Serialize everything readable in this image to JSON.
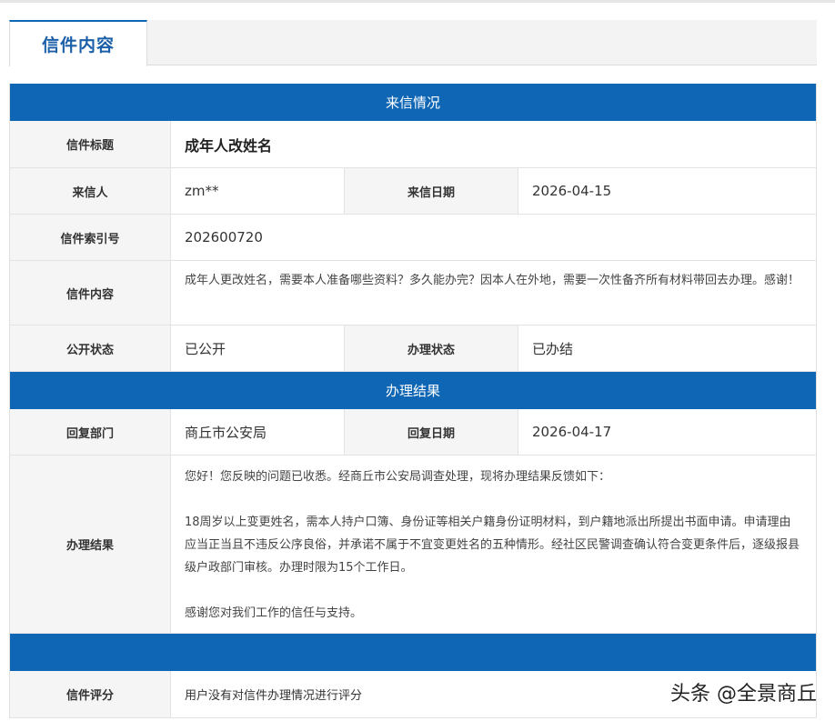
{
  "tab": {
    "label": "信件内容"
  },
  "section_letter": {
    "title": "来信情况"
  },
  "letter": {
    "title_label": "信件标题",
    "title_value": "成年人改姓名",
    "sender_label": "来信人",
    "sender_value": "zm**",
    "date_label": "来信日期",
    "date_value": "2026-04-15",
    "index_label": "信件索引号",
    "index_value": "202600720",
    "content_label": "信件内容",
    "content_value": "成年人更改姓名，需要本人准备哪些资料？多久能办完？因本人在外地，需要一次性备齐所有材料带回去办理。感谢！",
    "public_label": "公开状态",
    "public_value": "已公开",
    "process_label": "办理状态",
    "process_value": "已办结"
  },
  "section_result": {
    "title": "办理结果"
  },
  "result": {
    "dept_label": "回复部门",
    "dept_value": "商丘市公安局",
    "reply_date_label": "回复日期",
    "reply_date_value": "2026-04-17",
    "result_label": "办理结果",
    "paragraph_1": "您好！您反映的问题已收悉。经商丘市公安局调查处理，现将办理结果反馈如下：",
    "paragraph_2": "18周岁以上变更姓名，需本人持户口簿、身份证等相关户籍身份证明材料，到户籍地派出所提出书面申请。申请理由应当正当且不违反公序良俗，并承诺不属于不宜变更姓名的五种情形。经社区民警调查确认符合变更条件后，逐级报县级户政部门审核。办理时限为15个工作日。",
    "paragraph_3": "感谢您对我们工作的信任与支持。"
  },
  "rating": {
    "label": "信件评分",
    "value": "用户没有对信件办理情况进行评分"
  },
  "watermark": {
    "text": "头条 @全景商丘"
  },
  "colors": {
    "header_blue": "#0e66b5",
    "tab_text": "#1b5fa8",
    "label_bg": "#f5f5f5"
  }
}
